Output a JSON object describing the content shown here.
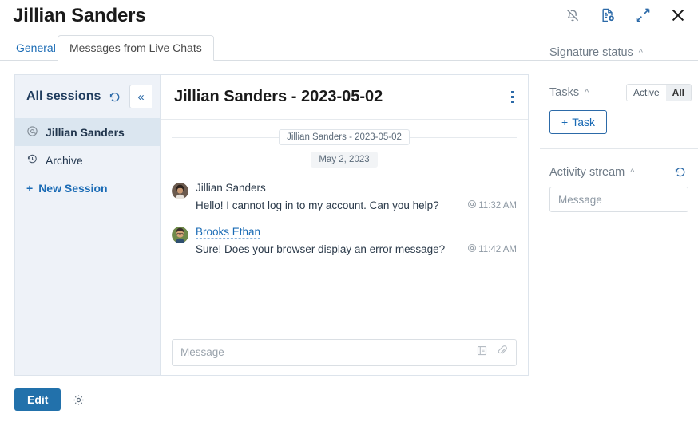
{
  "header": {
    "title": "Jillian Sanders",
    "icons": [
      {
        "name": "bell-off-icon",
        "label": "Mute notifications"
      },
      {
        "name": "document-add-icon",
        "label": "Document"
      },
      {
        "name": "expand-icon",
        "label": "Expand"
      },
      {
        "name": "close-icon",
        "label": "Close"
      }
    ]
  },
  "tabs": [
    {
      "label": "General",
      "active": false
    },
    {
      "label": "Messages from Live Chats",
      "active": true
    }
  ],
  "sessions": {
    "title": "All sessions",
    "refresh_label": "Refresh",
    "collapse_label": "«",
    "items": [
      {
        "label": "Jillian Sanders",
        "icon": "at-circle-icon",
        "active": true
      },
      {
        "label": "Archive",
        "icon": "history-icon",
        "active": false
      }
    ],
    "new_session_label": "New Session",
    "new_session_plus": "+"
  },
  "chat": {
    "title": "Jillian Sanders - 2023-05-02",
    "session_chip": "Jillian Sanders - 2023-05-02",
    "date_chip": "May 2, 2023",
    "messages": [
      {
        "author": "Jillian Sanders",
        "is_link": false,
        "text": "Hello! I cannot log in to my account. Can you help?",
        "time": "11:32 AM"
      },
      {
        "author": "Brooks Ethan",
        "is_link": true,
        "text": "Sure! Does your browser display an error message?",
        "time": "11:42 AM"
      }
    ],
    "input_placeholder": "Message"
  },
  "right_panel": {
    "signature": {
      "title": "Signature status"
    },
    "tasks": {
      "title": "Tasks",
      "filter_active": "Active",
      "filter_all": "All",
      "selected_filter": "All",
      "add_task_label": "Task",
      "add_task_plus": "+"
    },
    "activity": {
      "title": "Activity stream",
      "input_placeholder": "Message"
    }
  },
  "footer": {
    "edit_label": "Edit",
    "settings_icon": "gear-icon"
  },
  "colors": {
    "accent": "#1a6bb5",
    "button": "#2271ab",
    "sidebar_bg": "#eef2f8",
    "selected_item": "#dbe6f0"
  }
}
